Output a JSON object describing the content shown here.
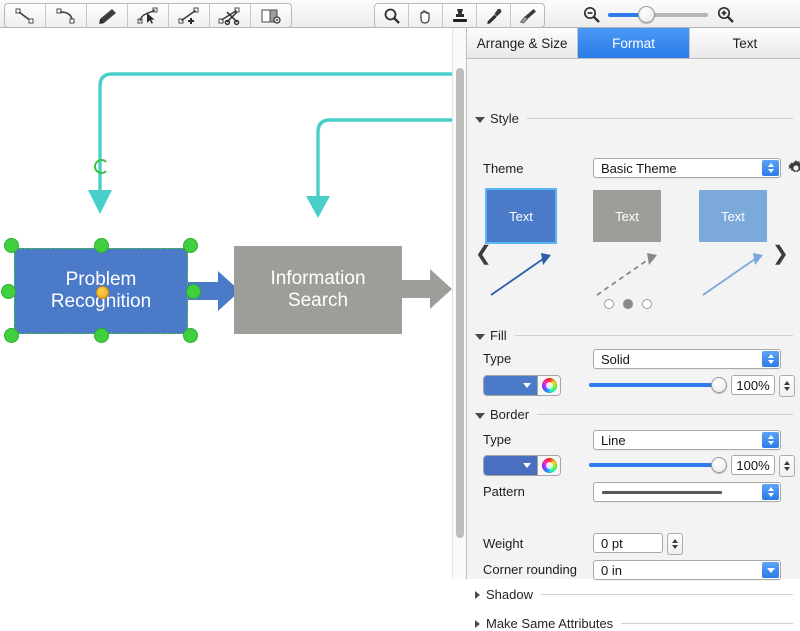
{
  "toolbar": {
    "left_tools": [
      {
        "name": "line-tool",
        "icon": "line-icon"
      },
      {
        "name": "curve-tool",
        "icon": "curve-icon"
      },
      {
        "name": "pen-tool",
        "icon": "pen-icon"
      },
      {
        "name": "edit-points-tool",
        "icon": "edit-points-icon"
      },
      {
        "name": "add-point-tool",
        "icon": "add-point-icon"
      },
      {
        "name": "cut-path-tool",
        "icon": "scissors-icon"
      },
      {
        "name": "mask-tool",
        "icon": "mask-icon"
      }
    ],
    "right_tools": [
      {
        "name": "zoom-tool",
        "icon": "magnifier-icon"
      },
      {
        "name": "pan-tool",
        "icon": "hand-icon"
      },
      {
        "name": "stamp-tool",
        "icon": "stamp-icon"
      },
      {
        "name": "eyedropper-tool",
        "icon": "eyedropper-icon"
      },
      {
        "name": "paintbrush-tool",
        "icon": "paintbrush-icon"
      }
    ],
    "zoom_out_icon": "zoom-out-icon",
    "zoom_in_icon": "zoom-in-icon",
    "zoom_value": 30
  },
  "canvas": {
    "shapes": [
      {
        "id": "problem-recognition",
        "label": "Problem\nRecognition",
        "line1": "Problem",
        "line2": "Recognition",
        "fill": "#4a7ac8",
        "selected": true
      },
      {
        "id": "information-search",
        "label": "Information\nSearch",
        "line1": "Information",
        "line2": "Search",
        "fill": "#9d9d99",
        "selected": false
      }
    ],
    "connectors": [
      {
        "id": "cyan-connector-left",
        "color": "#49cfc9"
      },
      {
        "id": "cyan-connector-right",
        "color": "#49cfc9"
      }
    ],
    "block_arrows": [
      {
        "id": "blue-block-arrow",
        "color": "#4a7ac8"
      },
      {
        "id": "gray-block-arrow",
        "color": "#9d9d99"
      }
    ],
    "selection_handle_color": "#3fcf3f",
    "rotation_handle_color": "#e8a21d"
  },
  "inspector": {
    "tabs": [
      {
        "id": "arrange-size",
        "label": "Arrange & Size",
        "active": false
      },
      {
        "id": "format",
        "label": "Format",
        "active": true
      },
      {
        "id": "text",
        "label": "Text",
        "active": false
      }
    ],
    "style": {
      "section_label": "Style",
      "expanded": true,
      "theme_label": "Theme",
      "theme_value": "Basic Theme",
      "gear_icon": "gear-icon",
      "prev_icon": "chevron-left-icon",
      "next_icon": "chevron-right-icon",
      "swatches": [
        {
          "label": "Text",
          "fill": "#4a7ac8",
          "arrow": "#2b5fae",
          "selected": true,
          "dash": false
        },
        {
          "label": "Text",
          "fill": "#9d9d99",
          "arrow": "#8a8a85",
          "selected": false,
          "dash": true
        },
        {
          "label": "Text",
          "fill": "#7ba9da",
          "arrow": "#7ba9da",
          "selected": false,
          "dash": false
        }
      ],
      "pager": {
        "count": 3,
        "active_index": 1
      }
    },
    "fill": {
      "section_label": "Fill",
      "expanded": true,
      "type_label": "Type",
      "type_value": "Solid",
      "color": "#4a7ac8",
      "opacity_label": "100%"
    },
    "border": {
      "section_label": "Border",
      "expanded": true,
      "type_label": "Type",
      "type_value": "Line",
      "color": "#4a6ec0",
      "opacity_label": "100%",
      "pattern_label": "Pattern",
      "pattern_value": "",
      "weight_label": "Weight",
      "weight_value": "0 pt",
      "corner_label": "Corner rounding",
      "corner_value": "0 in"
    },
    "shadow": {
      "section_label": "Shadow",
      "expanded": false
    },
    "make_same": {
      "section_label": "Make Same Attributes",
      "expanded": false
    }
  }
}
